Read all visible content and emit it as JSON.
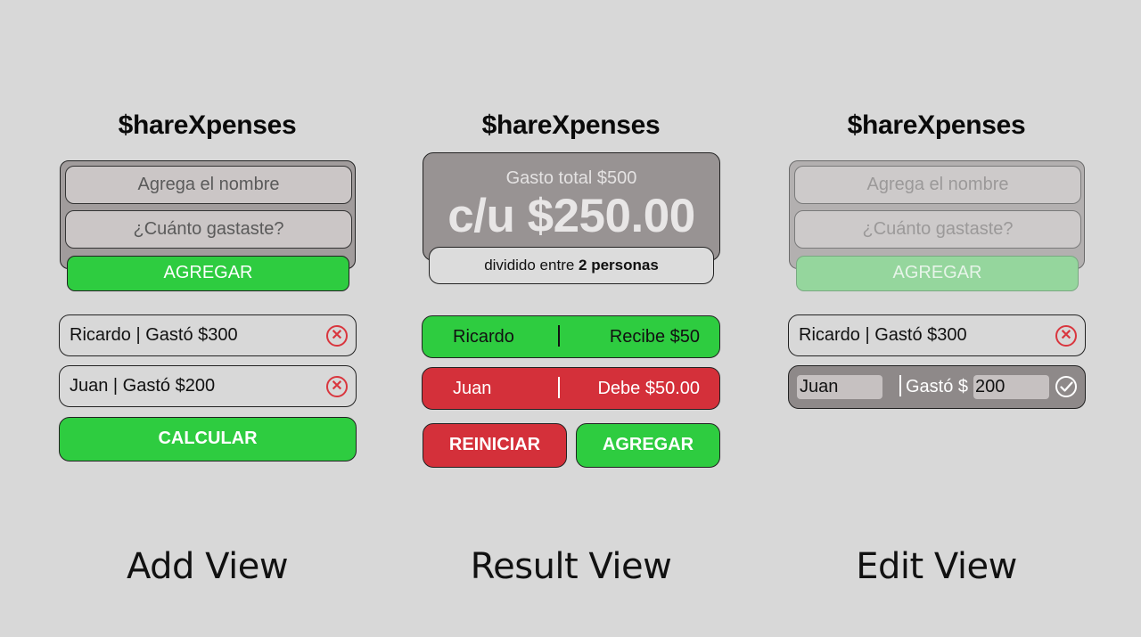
{
  "add_view": {
    "app_title": "$hareXpenses",
    "name_placeholder": "Agrega el nombre",
    "amount_placeholder": "¿Cuánto gastaste?",
    "add_button": "AGREGAR",
    "people": [
      {
        "label": "Ricardo | Gastó $300",
        "delete_icon": "close-circle-icon"
      },
      {
        "label": "Juan | Gastó $200",
        "delete_icon": "close-circle-icon"
      }
    ],
    "calculate_button": "CALCULAR",
    "view_label": "Add View"
  },
  "result_view": {
    "app_title": "$hareXpenses",
    "total": "Gasto total $500",
    "per_person": "c/u $250.00",
    "split_prefix": "dividido entre ",
    "split_count": "2 personas",
    "results": [
      {
        "name": "Ricardo",
        "amount": "Recibe $50",
        "status": "receive",
        "color": "#2ecc40"
      },
      {
        "name": "Juan",
        "amount": "Debe $50.00",
        "status": "owe",
        "color": "#d4303a"
      }
    ],
    "reset_button": "REINICIAR",
    "add_button": "AGREGAR",
    "view_label": "Result View"
  },
  "edit_view": {
    "app_title": "$hareXpenses",
    "name_placeholder": "Agrega el nombre",
    "amount_placeholder": "¿Cuánto gastaste?",
    "add_button": "AGREGAR",
    "people": [
      {
        "label": "Ricardo | Gastó $300",
        "delete_icon": "close-circle-icon"
      }
    ],
    "editing": {
      "name_value": "Juan",
      "gasto_label": "| Gastó $",
      "amount_value": "200",
      "confirm_icon": "check-circle-icon"
    },
    "view_label": "Edit View"
  },
  "colors": {
    "background": "#d8d8d8",
    "green": "#2ecc40",
    "red": "#d4303a",
    "panel_gray": "#989393"
  }
}
